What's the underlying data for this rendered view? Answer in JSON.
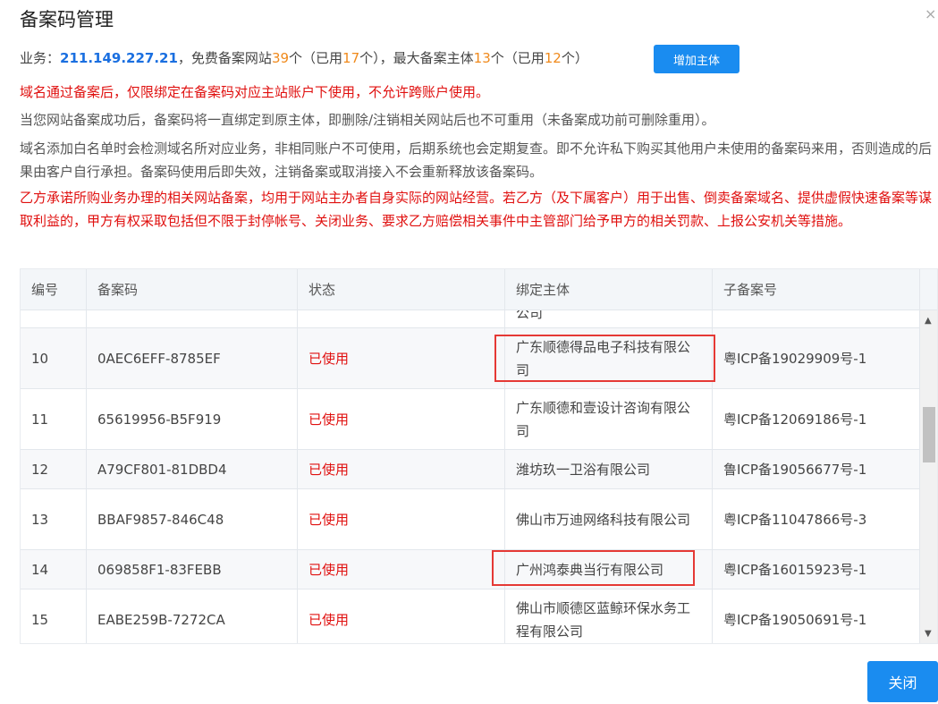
{
  "dialog": {
    "title": "备案码管理",
    "close_icon": "×",
    "close_button": "关闭"
  },
  "business": {
    "label": "业务：",
    "ip": "211.149.227.21",
    "t1": "，免费备案网站",
    "free_sites": "39",
    "t2": "个（已用",
    "used_sites": "17",
    "t3": "个），最大备案主体",
    "max_entities": "13",
    "t4": "个（已用",
    "used_entities": "12",
    "t5": "个）",
    "add_button": "增加主体"
  },
  "notes": [
    "域名通过备案后，仅限绑定在备案码对应主站账户下使用，不允许跨账户使用。",
    "当您网站备案成功后，备案码将一直绑定到原主体，即删除/注销相关网站后也不可重用（未备案成功前可删除重用）。",
    "域名添加白名单时会检测域名所对应业务，非相同账户不可使用，后期系统也会定期复查。即不允许私下购买其他用户未使用的备案码来用，否则造成的后果由客户自行承担。备案码使用后即失效，注销备案或取消接入不会重新释放该备案码。",
    "乙方承诺所购业务办理的相关网站备案，均用于网站主办者自身实际的网站经营。若乙方（及下属客户）用于出售、倒卖备案域名、提供虚假快速备案等谋取利益的，甲方有权采取包括但不限于封停帐号、关闭业务、要求乙方赔偿相关事件中主管部门给予甲方的相关罚款、上报公安机关等措施。"
  ],
  "table": {
    "headers": [
      "编号",
      "备案码",
      "状态",
      "绑定主体",
      "子备案号"
    ],
    "partial_row_text": "公司",
    "rows": [
      {
        "id": "10",
        "code": "0AEC6EFF-8785EF",
        "status": "已使用",
        "entity": "广东顺德得品电子科技有限公司",
        "icp": "粤ICP备19029909号-1"
      },
      {
        "id": "11",
        "code": "65619956-B5F919",
        "status": "已使用",
        "entity": "广东顺德和壹设计咨询有限公司",
        "icp": "粤ICP备12069186号-1"
      },
      {
        "id": "12",
        "code": "A79CF801-81DBD4",
        "status": "已使用",
        "entity": "潍坊玖一卫浴有限公司",
        "icp": "鲁ICP备19056677号-1"
      },
      {
        "id": "13",
        "code": "BBAF9857-846C48",
        "status": "已使用",
        "entity": "佛山市万迪网络科技有限公司",
        "icp": "粤ICP备11047866号-3"
      },
      {
        "id": "14",
        "code": "069858F1-83FEBB",
        "status": "已使用",
        "entity": "广州鸿泰典当行有限公司",
        "icp": "粤ICP备16015923号-1"
      },
      {
        "id": "15",
        "code": "EABE259B-7272CA",
        "status": "已使用",
        "entity": "佛山市顺德区蓝鲸环保水务工程有限公司",
        "icp": "粤ICP备19050691号-1"
      }
    ]
  },
  "colors": {
    "accent": "#1a8cf0",
    "warning_red": "#e0100f",
    "number_orange": "#f08a1c",
    "highlight_box": "#e53935"
  },
  "icons": {
    "scroll_up": "▲",
    "scroll_down": "▼"
  }
}
